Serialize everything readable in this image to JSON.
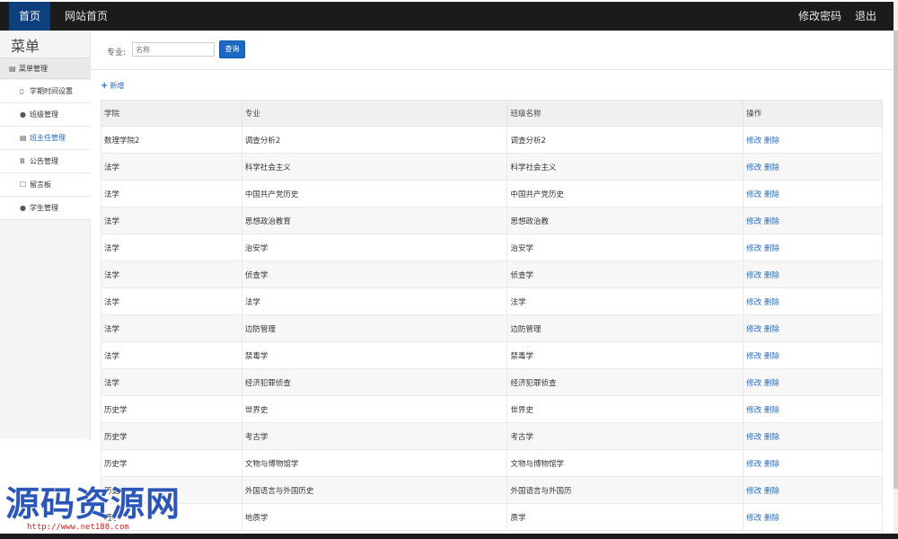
{
  "nav": {
    "home": "首页",
    "site_home": "网站首页",
    "change_password": "修改密码",
    "logout": "退出"
  },
  "sidebar": {
    "title": "菜单",
    "group": "菜单管理",
    "items": [
      {
        "label": "学期时间设置",
        "icon": "document-icon"
      },
      {
        "label": "班级管理",
        "icon": "comment-icon"
      },
      {
        "label": "班主任管理",
        "icon": "list-icon"
      },
      {
        "label": "公告管理",
        "icon": "books-icon"
      },
      {
        "label": "留言板",
        "icon": "message-icon"
      },
      {
        "label": "学生管理",
        "icon": "comment-icon"
      }
    ],
    "active_index": 2
  },
  "search": {
    "label": "专业:",
    "placeholder": "名称",
    "button": "查询"
  },
  "add_label": "新增",
  "table": {
    "headers": [
      "学院",
      "专业",
      "班级名称",
      "操作"
    ],
    "rows": [
      [
        "数理学院2",
        "调查分析2",
        "调查分析2"
      ],
      [
        "法学",
        "科学社会主义",
        "科学社会主义"
      ],
      [
        "法学",
        "中国共产党历史",
        "中国共产党历史"
      ],
      [
        "法学",
        "思想政治教育",
        "思想政治教"
      ],
      [
        "法学",
        "治安学",
        "治安学"
      ],
      [
        "法学",
        "侦查学",
        "侦查学"
      ],
      [
        "法学",
        "法学",
        "法学"
      ],
      [
        "法学",
        "边防管理",
        "边防管理"
      ],
      [
        "法学",
        "禁毒学",
        "禁毒学"
      ],
      [
        "法学",
        "经济犯罪侦查",
        "经济犯罪侦查"
      ],
      [
        "历史学",
        "世界史",
        "世界史"
      ],
      [
        "历史学",
        "考古学",
        "考古学"
      ],
      [
        "历史学",
        "文物与博物馆学",
        "文物与博物馆学"
      ],
      [
        "历史学",
        "外国语言与外国历史",
        "外国语言与外国历"
      ],
      [
        "理学",
        "地质学",
        "质学"
      ]
    ],
    "edit_label": "修改",
    "delete_label": "删除"
  },
  "watermark": {
    "title": "源码资源网",
    "url": "http://www.net188.com"
  },
  "colors": {
    "topbar": "#1b1b1b",
    "active_nav": "#0e3f7e",
    "link": "#2a6ab3",
    "button": "#1d69c1"
  }
}
